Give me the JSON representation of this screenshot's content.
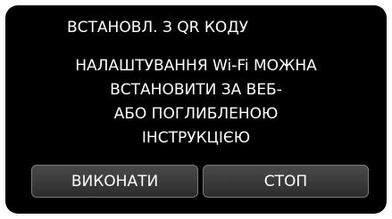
{
  "dialog": {
    "title": "ВСТАНОВЛ. З QR КОДУ",
    "message_lines": [
      "НАЛАШТУВАННЯ Wi-Fi МОЖНА",
      "ВСТАНОВИТИ ЗА ВЕБ-",
      "АБО ПОГЛИБЛЕНОЮ",
      "ІНСТРУКЦІЄЮ"
    ],
    "execute_label": "ВИКОНАТИ",
    "stop_label": "СТОП"
  },
  "colors": {
    "screen_background": "#000000",
    "text": "#ffffff",
    "button_border": "#7a7a7a"
  }
}
